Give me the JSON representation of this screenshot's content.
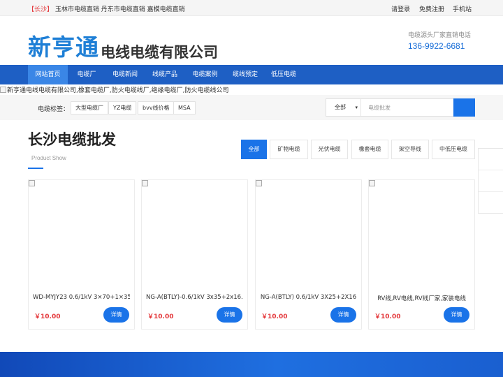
{
  "topbar": {
    "city": "【长沙】",
    "links_left": "玉林市电缆直销 丹东市电缆直销 嘉模电缆直销",
    "login": "请登录",
    "register": "免费注册",
    "mobile": "手机站"
  },
  "header": {
    "brand": "新亨通",
    "company": "电线电缆有限公司",
    "hotline_label": "电缆源头厂家直销电话",
    "hotline_phone": "136-9922-6681"
  },
  "nav": {
    "items": [
      {
        "label": "网站首页"
      },
      {
        "label": "电缆厂"
      },
      {
        "label": "电缆新闻"
      },
      {
        "label": "线缆产品"
      },
      {
        "label": "电缆案例"
      },
      {
        "label": "缆线预定"
      },
      {
        "label": "低压电缆"
      }
    ]
  },
  "banner": {
    "alt": "新亨通电线电缆有限公司,橡套电缆厂,防火电缆线厂,绝缘电缆厂,防火电缆线公司"
  },
  "tags": {
    "label": "电缆标签：",
    "items": [
      "大型电缆厂",
      "YZ电缆",
      "bvv线价格",
      "MSA"
    ]
  },
  "search": {
    "select_value": "全部",
    "placeholder": "电缆批发"
  },
  "section": {
    "title": "长沙电缆批发",
    "subtitle": "Product Show"
  },
  "filters": [
    "全部",
    "矿物电缆",
    "光伏电缆",
    "橡套电缆",
    "架空导线",
    "中低压电缆"
  ],
  "products": [
    {
      "name": "WD-MYJY23 0.6/1kV 3×70+1×35",
      "price": "￥10.00",
      "detail": "详情"
    },
    {
      "name": "NG-A(BTLY)-0.6/1kV 3x35+2x16...",
      "price": "￥10.00",
      "detail": "详情"
    },
    {
      "name": "NG-A(BTLY) 0.6/1kV 3X25+2X16",
      "price": "￥10.00",
      "detail": "详情"
    },
    {
      "name": "RV线,RV电线,RV线厂家,家装电线",
      "price": "￥10.00",
      "detail": "详情"
    }
  ],
  "colors": {
    "nav_bg": "#1e5fc4",
    "accent": "#1a73e8",
    "price": "#e4393c"
  }
}
